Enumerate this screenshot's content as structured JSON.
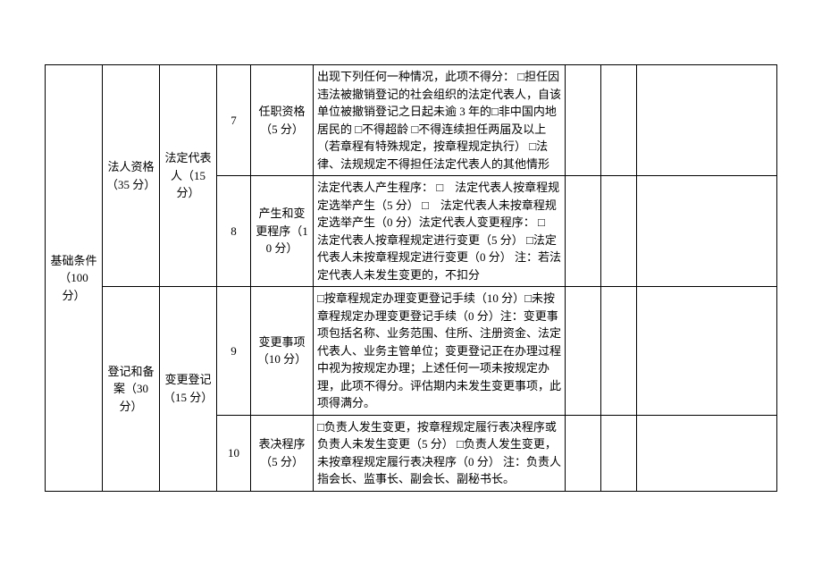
{
  "cat1": {
    "label": "基础条件（100 分）"
  },
  "sub1": {
    "label": "法人资格（35 分）"
  },
  "sub2": {
    "label": "登记和备案（30 分）"
  },
  "group1": {
    "label": "法定代表人（15 分）"
  },
  "group2": {
    "label": "变更登记（15 分）"
  },
  "rows": [
    {
      "num": "7",
      "item": "任职资格（5 分）",
      "desc": "出现下列任何一种情况，此项不得分：\n□担任因违法被撤销登记的社会组织的法定代表人，自该单位被撤销登记之日起未逾 3 年的□非中国内地居民的\n□不得超龄\n□不得连续担任两届及以上（若章程有特殊规定，按章程规定执行）\n□法律、法规规定不得担任法定代表人的其他情形"
    },
    {
      "num": "8",
      "item": "产生和变更程序（10 分）",
      "desc": "法定代表人产生程序：\n□　法定代表人按章程规定选举产生（5 分）\n□　法定代表人未按章程规定选举产生（0 分）法定代表人变更程序：\n□　法定代表人按章程规定进行变更（5 分）\n□法定代表人未按章程规定进行变更（0 分）\n注：若法定代表人未发生变更的，不扣分"
    },
    {
      "num": "9",
      "item": "变更事项（10 分）",
      "desc": "□按章程规定办理变更登记手续（10 分）□未按章程规定办理变更登记手续（0 分）注：变更事项包括名称、业务范围、住所、注册资金、法定代表人、业务主管单位；变更登记正在办理过程中视为按规定办理；上述任何一项未按规定办理，此项不得分。评估期内未发生变更事项，此项得满分。"
    },
    {
      "num": "10",
      "item": "表决程序（5 分）",
      "desc": "□负责人发生变更，按章程规定履行表决程序或负责人未发生变更（5 分）\n□负责人发生变更，未按章程规定履行表决程序（0 分）\n注：负责人指会长、监事长、副会长、副秘书长。"
    }
  ]
}
